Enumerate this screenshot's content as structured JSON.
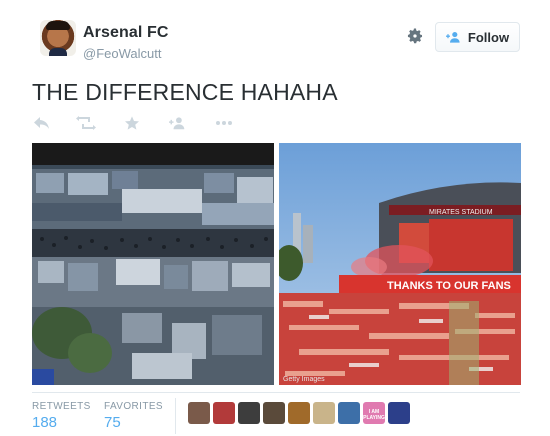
{
  "user": {
    "name": "Arsenal FC",
    "handle": "@FeoWalcutt",
    "avatar_icon": "profile-photo"
  },
  "header": {
    "gear_icon": "gear-icon",
    "follow_label": "Follow",
    "follow_icon": "add-user-icon"
  },
  "tweet": {
    "text": "THE DIFFERENCE HAHAHA"
  },
  "actions": [
    {
      "name": "reply",
      "icon": "reply-icon"
    },
    {
      "name": "retweet",
      "icon": "retweet-icon"
    },
    {
      "name": "favorite",
      "icon": "star-icon"
    },
    {
      "name": "follow",
      "icon": "add-user-icon"
    },
    {
      "name": "more",
      "icon": "more-icon"
    }
  ],
  "media": {
    "left_description_icon": "aerial-crowd-photo",
    "right_banner_text": "THANKS TO OUR FANS",
    "right_stadium_text": "MIRATES STADIUM",
    "right_caption": "Getty Images"
  },
  "stats": {
    "retweets_label": "RETWEETS",
    "retweets_value": "188",
    "favorites_label": "FAVORITES",
    "favorites_value": "75"
  },
  "favoriters": [
    {
      "color": "#7a5a4a"
    },
    {
      "color": "#b23a3a"
    },
    {
      "color": "#3d3d3d"
    },
    {
      "color": "#5a4a3a"
    },
    {
      "color": "#a06a2a"
    },
    {
      "color": "#c9b48a"
    },
    {
      "color": "#3d6fa8"
    },
    {
      "color": "#e07ab0",
      "label": "I AM PLAYING"
    },
    {
      "color": "#2c3f8a"
    }
  ],
  "colors": {
    "accent": "#55acee",
    "muted": "#8899a6",
    "icon": "#ccd6dd"
  }
}
